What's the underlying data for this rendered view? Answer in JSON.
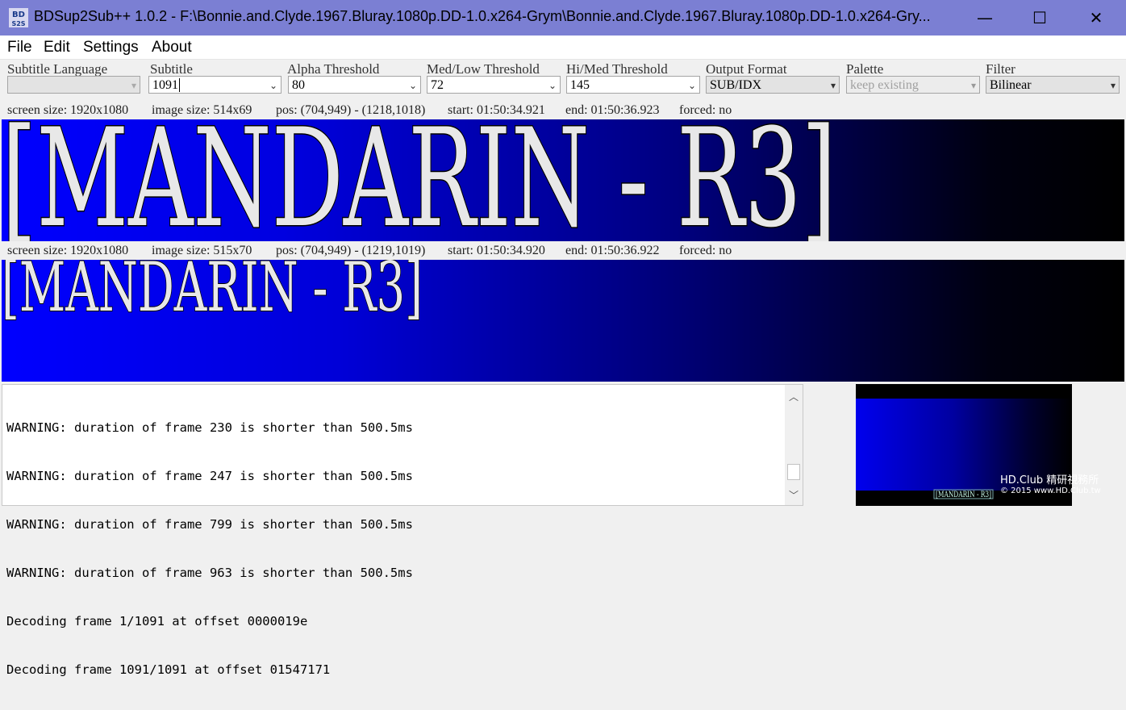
{
  "window": {
    "title": "BDSup2Sub++ 1.0.2 - F:\\Bonnie.and.Clyde.1967.Bluray.1080p.DD-1.0.x264-Grym\\Bonnie.and.Clyde.1967.Bluray.1080p.DD-1.0.x264-Gry...",
    "icon_text_top": "BD",
    "icon_text_bottom": "S2S",
    "minimize_glyph": "—",
    "maximize_glyph": "☐",
    "close_glyph": "✕"
  },
  "menu": [
    "File",
    "Edit",
    "Settings",
    "About"
  ],
  "toolbar": {
    "subtitle_language": {
      "label": "Subtitle Language",
      "value": ""
    },
    "subtitle": {
      "label": "Subtitle",
      "value": "1091"
    },
    "alpha_threshold": {
      "label": "Alpha Threshold",
      "value": "80"
    },
    "med_low_threshold": {
      "label": "Med/Low Threshold",
      "value": "72"
    },
    "hi_med_threshold": {
      "label": "Hi/Med Threshold",
      "value": "145"
    },
    "output_format": {
      "label": "Output Format",
      "value": "SUB/IDX"
    },
    "palette": {
      "label": "Palette",
      "value": "keep existing"
    },
    "filter": {
      "label": "Filter",
      "value": "Bilinear"
    }
  },
  "source_info": {
    "screen_size": "screen size: 1920x1080",
    "image_size": "image size: 514x69",
    "pos": "pos: (704,949) - (1218,1018)",
    "start": "start: 01:50:34.921",
    "end": "end: 01:50:36.923",
    "forced": "forced: no"
  },
  "source_caption": "[MANDARIN - R3]",
  "target_info": {
    "screen_size": "screen size: 1920x1080",
    "image_size": "image size: 515x70",
    "pos": "pos: (704,949) - (1219,1019)",
    "start": "start: 01:50:34.920",
    "end": "end: 01:50:36.922",
    "forced": "forced: no"
  },
  "target_caption": "[MANDARIN - R3]",
  "log": [
    "WARNING: duration of frame 230 is shorter than 500.5ms",
    "WARNING: duration of frame 247 is shorter than 500.5ms",
    "WARNING: duration of frame 799 is shorter than 500.5ms",
    "WARNING: duration of frame 963 is shorter than 500.5ms",
    "Decoding frame 1/1091 at offset 0000019e",
    "Decoding frame 1091/1091 at offset 01547171"
  ],
  "thumbnail_caption": "[MANDARIN - R3]",
  "watermark": {
    "line1": "HD.Club 精研視務所",
    "line2": "© 2015  www.HD.Club.tw"
  },
  "colors": {
    "titlebar": "#7b7fd3",
    "preview_blue": "#0000ff"
  }
}
